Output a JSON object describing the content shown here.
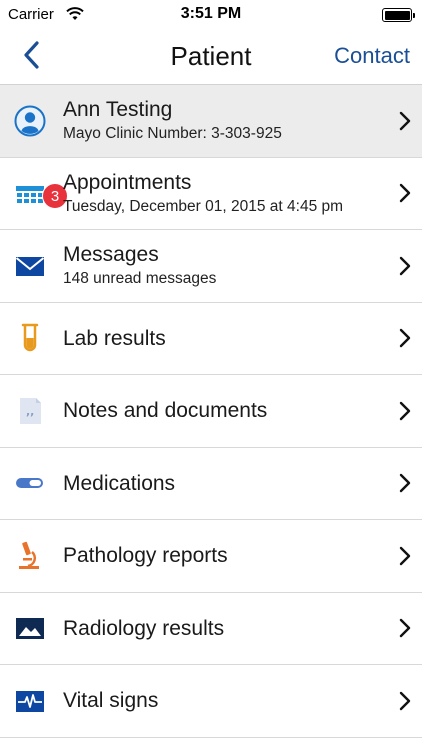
{
  "status_bar": {
    "carrier": "Carrier",
    "time": "3:51 PM"
  },
  "nav": {
    "title": "Patient",
    "contact_label": "Contact"
  },
  "colors": {
    "accent": "#1a4f96",
    "badge": "#e8333c",
    "icon_blue": "#1a73c8",
    "icon_orange": "#e8732a",
    "icon_navy": "#0f2a52"
  },
  "rows": [
    {
      "icon": "person-icon",
      "title": "Ann Testing",
      "subtitle": "Mayo Clinic Number:  3-303-925"
    },
    {
      "icon": "calendar-icon",
      "title": "Appointments",
      "subtitle": "Tuesday, December 01, 2015 at 4:45 pm",
      "badge": "3"
    },
    {
      "icon": "envelope-icon",
      "title": "Messages",
      "subtitle": "148 unread messages"
    },
    {
      "icon": "test-tube-icon",
      "title": "Lab results"
    },
    {
      "icon": "document-icon",
      "title": "Notes and documents"
    },
    {
      "icon": "pill-icon",
      "title": "Medications"
    },
    {
      "icon": "microscope-icon",
      "title": "Pathology reports"
    },
    {
      "icon": "image-icon",
      "title": "Radiology results"
    },
    {
      "icon": "heartbeat-icon",
      "title": "Vital signs"
    }
  ]
}
